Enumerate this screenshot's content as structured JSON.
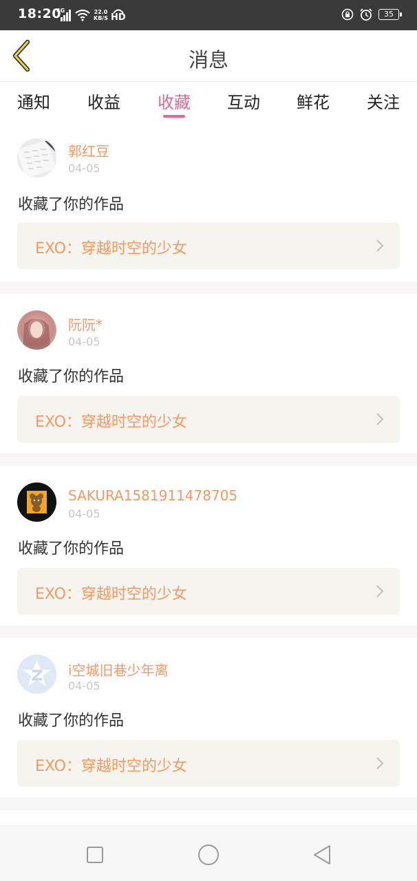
{
  "status_bar": {
    "time": "18:20",
    "network_type": "4G",
    "net_speed_value": "22.0",
    "net_speed_unit": "KB/S",
    "hd_label": "HD",
    "battery": "35"
  },
  "header": {
    "title": "消息",
    "back_icon": "chevron-left-icon"
  },
  "tabs": [
    {
      "label": "通知",
      "active": false
    },
    {
      "label": "收益",
      "active": false
    },
    {
      "label": "收藏",
      "active": true
    },
    {
      "label": "互动",
      "active": false
    },
    {
      "label": "鲜花",
      "active": false
    },
    {
      "label": "关注",
      "active": false
    }
  ],
  "colors": {
    "accent": "#e8659a",
    "username": "#f29a62",
    "work_bg": "#f5f4ee"
  },
  "messages": [
    {
      "username": "郭红豆",
      "date": "04-05",
      "action": "收藏了你的作品",
      "work_title": "EXO：穿越时空的少女"
    },
    {
      "username": "阮阮*",
      "date": "04-05",
      "action": "收藏了你的作品",
      "work_title": "EXO：穿越时空的少女"
    },
    {
      "username": "SAKURA1581911478705",
      "date": "04-05",
      "action": "收藏了你的作品",
      "work_title": "EXO：穿越时空的少女"
    },
    {
      "username": "i空城旧巷少年离",
      "date": "04-05",
      "action": "收藏了你的作品",
      "work_title": "EXO：穿越时空的少女"
    }
  ],
  "nav_bar": {
    "recents_icon": "square-icon",
    "home_icon": "circle-icon",
    "back_icon": "triangle-back-icon"
  }
}
